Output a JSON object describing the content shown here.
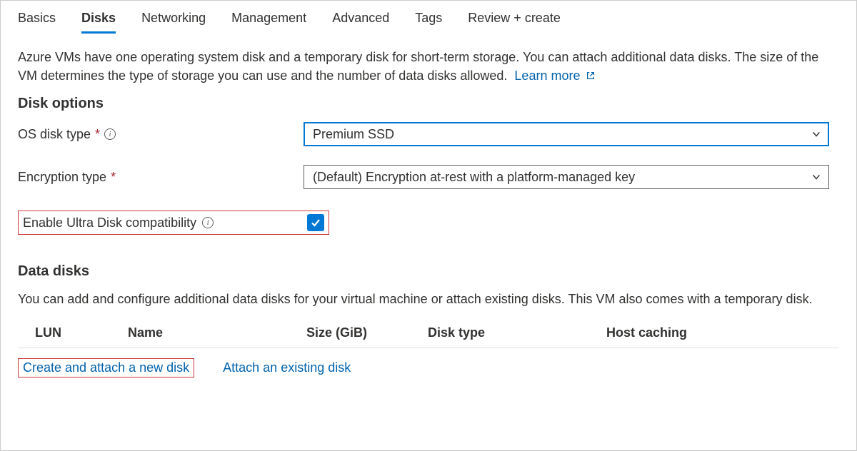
{
  "tabs": [
    "Basics",
    "Disks",
    "Networking",
    "Management",
    "Advanced",
    "Tags",
    "Review + create"
  ],
  "activeTab": "Disks",
  "intro": {
    "text": "Azure VMs have one operating system disk and a temporary disk for short-term storage. You can attach additional data disks. The size of the VM determines the type of storage you can use and the number of data disks allowed.",
    "learnMore": "Learn more"
  },
  "sections": {
    "diskOptionsTitle": "Disk options",
    "dataDisksTitle": "Data disks"
  },
  "form": {
    "osDiskType": {
      "label": "OS disk type",
      "value": "Premium SSD"
    },
    "encryptionType": {
      "label": "Encryption type",
      "value": "(Default) Encryption at-rest with a platform-managed key"
    },
    "ultra": {
      "label": "Enable Ultra Disk compatibility",
      "checked": true
    }
  },
  "dataDisks": {
    "desc": "You can add and configure additional data disks for your virtual machine or attach existing disks. This VM also comes with a temporary disk.",
    "columns": [
      "LUN",
      "Name",
      "Size (GiB)",
      "Disk type",
      "Host caching"
    ]
  },
  "actions": {
    "create": "Create and attach a new disk",
    "attach": "Attach an existing disk"
  }
}
